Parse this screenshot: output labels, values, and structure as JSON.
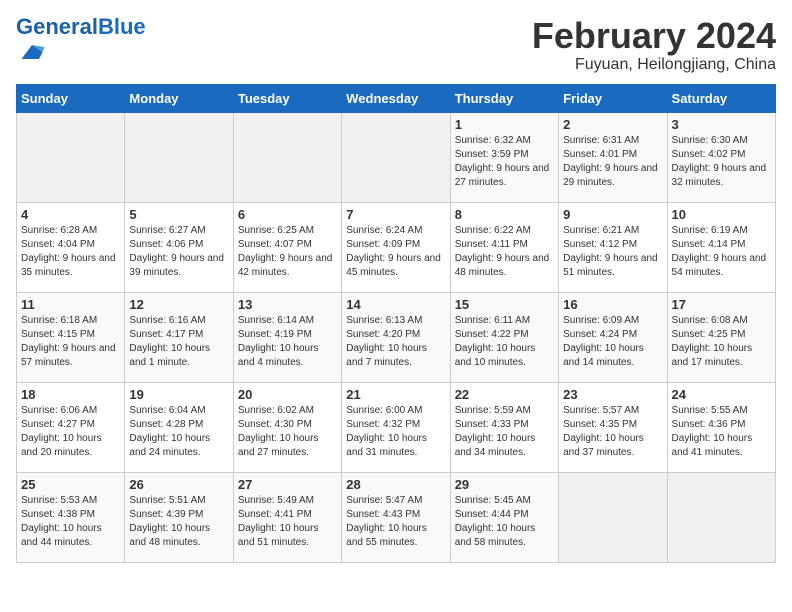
{
  "header": {
    "logo_general": "General",
    "logo_blue": "Blue",
    "month_title": "February 2024",
    "location": "Fuyuan, Heilongjiang, China"
  },
  "days_of_week": [
    "Sunday",
    "Monday",
    "Tuesday",
    "Wednesday",
    "Thursday",
    "Friday",
    "Saturday"
  ],
  "weeks": [
    [
      {
        "day": "",
        "info": ""
      },
      {
        "day": "",
        "info": ""
      },
      {
        "day": "",
        "info": ""
      },
      {
        "day": "",
        "info": ""
      },
      {
        "day": "1",
        "info": "Sunrise: 6:32 AM\nSunset: 3:59 PM\nDaylight: 9 hours and 27 minutes."
      },
      {
        "day": "2",
        "info": "Sunrise: 6:31 AM\nSunset: 4:01 PM\nDaylight: 9 hours and 29 minutes."
      },
      {
        "day": "3",
        "info": "Sunrise: 6:30 AM\nSunset: 4:02 PM\nDaylight: 9 hours and 32 minutes."
      }
    ],
    [
      {
        "day": "4",
        "info": "Sunrise: 6:28 AM\nSunset: 4:04 PM\nDaylight: 9 hours and 35 minutes."
      },
      {
        "day": "5",
        "info": "Sunrise: 6:27 AM\nSunset: 4:06 PM\nDaylight: 9 hours and 39 minutes."
      },
      {
        "day": "6",
        "info": "Sunrise: 6:25 AM\nSunset: 4:07 PM\nDaylight: 9 hours and 42 minutes."
      },
      {
        "day": "7",
        "info": "Sunrise: 6:24 AM\nSunset: 4:09 PM\nDaylight: 9 hours and 45 minutes."
      },
      {
        "day": "8",
        "info": "Sunrise: 6:22 AM\nSunset: 4:11 PM\nDaylight: 9 hours and 48 minutes."
      },
      {
        "day": "9",
        "info": "Sunrise: 6:21 AM\nSunset: 4:12 PM\nDaylight: 9 hours and 51 minutes."
      },
      {
        "day": "10",
        "info": "Sunrise: 6:19 AM\nSunset: 4:14 PM\nDaylight: 9 hours and 54 minutes."
      }
    ],
    [
      {
        "day": "11",
        "info": "Sunrise: 6:18 AM\nSunset: 4:15 PM\nDaylight: 9 hours and 57 minutes."
      },
      {
        "day": "12",
        "info": "Sunrise: 6:16 AM\nSunset: 4:17 PM\nDaylight: 10 hours and 1 minute."
      },
      {
        "day": "13",
        "info": "Sunrise: 6:14 AM\nSunset: 4:19 PM\nDaylight: 10 hours and 4 minutes."
      },
      {
        "day": "14",
        "info": "Sunrise: 6:13 AM\nSunset: 4:20 PM\nDaylight: 10 hours and 7 minutes."
      },
      {
        "day": "15",
        "info": "Sunrise: 6:11 AM\nSunset: 4:22 PM\nDaylight: 10 hours and 10 minutes."
      },
      {
        "day": "16",
        "info": "Sunrise: 6:09 AM\nSunset: 4:24 PM\nDaylight: 10 hours and 14 minutes."
      },
      {
        "day": "17",
        "info": "Sunrise: 6:08 AM\nSunset: 4:25 PM\nDaylight: 10 hours and 17 minutes."
      }
    ],
    [
      {
        "day": "18",
        "info": "Sunrise: 6:06 AM\nSunset: 4:27 PM\nDaylight: 10 hours and 20 minutes."
      },
      {
        "day": "19",
        "info": "Sunrise: 6:04 AM\nSunset: 4:28 PM\nDaylight: 10 hours and 24 minutes."
      },
      {
        "day": "20",
        "info": "Sunrise: 6:02 AM\nSunset: 4:30 PM\nDaylight: 10 hours and 27 minutes."
      },
      {
        "day": "21",
        "info": "Sunrise: 6:00 AM\nSunset: 4:32 PM\nDaylight: 10 hours and 31 minutes."
      },
      {
        "day": "22",
        "info": "Sunrise: 5:59 AM\nSunset: 4:33 PM\nDaylight: 10 hours and 34 minutes."
      },
      {
        "day": "23",
        "info": "Sunrise: 5:57 AM\nSunset: 4:35 PM\nDaylight: 10 hours and 37 minutes."
      },
      {
        "day": "24",
        "info": "Sunrise: 5:55 AM\nSunset: 4:36 PM\nDaylight: 10 hours and 41 minutes."
      }
    ],
    [
      {
        "day": "25",
        "info": "Sunrise: 5:53 AM\nSunset: 4:38 PM\nDaylight: 10 hours and 44 minutes."
      },
      {
        "day": "26",
        "info": "Sunrise: 5:51 AM\nSunset: 4:39 PM\nDaylight: 10 hours and 48 minutes."
      },
      {
        "day": "27",
        "info": "Sunrise: 5:49 AM\nSunset: 4:41 PM\nDaylight: 10 hours and 51 minutes."
      },
      {
        "day": "28",
        "info": "Sunrise: 5:47 AM\nSunset: 4:43 PM\nDaylight: 10 hours and 55 minutes."
      },
      {
        "day": "29",
        "info": "Sunrise: 5:45 AM\nSunset: 4:44 PM\nDaylight: 10 hours and 58 minutes."
      },
      {
        "day": "",
        "info": ""
      },
      {
        "day": "",
        "info": ""
      }
    ]
  ]
}
